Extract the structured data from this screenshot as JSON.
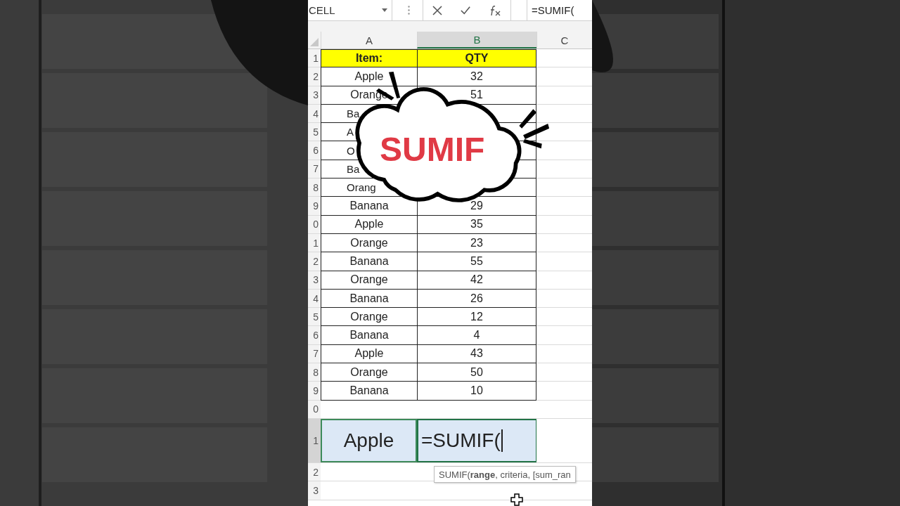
{
  "formula_bar": {
    "name_box": "CELL",
    "formula": "=SUMIF("
  },
  "columns": [
    {
      "label": "A",
      "selected": false
    },
    {
      "label": "B",
      "selected": true
    },
    {
      "label": "C",
      "selected": false
    }
  ],
  "rows": [
    {
      "number": "1",
      "selected": false,
      "kind": "header",
      "cells": [
        {
          "text": "Item:",
          "covered": false
        },
        {
          "text": "QTY",
          "covered": false
        }
      ]
    },
    {
      "number": "2",
      "selected": false,
      "kind": "data",
      "cells": [
        {
          "text": "Apple",
          "covered": false
        },
        {
          "text": "32",
          "covered": false
        }
      ]
    },
    {
      "number": "3",
      "selected": false,
      "kind": "data",
      "cells": [
        {
          "text": "Orange",
          "covered": false
        },
        {
          "text": "51",
          "covered": false
        }
      ]
    },
    {
      "number": "4",
      "selected": false,
      "kind": "data",
      "cells": [
        {
          "text": "Ba",
          "covered": true
        }
      ]
    },
    {
      "number": "5",
      "selected": false,
      "kind": "data",
      "cells": [
        {
          "text": "A",
          "covered": true
        }
      ]
    },
    {
      "number": "6",
      "selected": false,
      "kind": "data",
      "cells": [
        {
          "text": "O",
          "covered": true
        }
      ]
    },
    {
      "number": "7",
      "selected": false,
      "kind": "data",
      "cells": [
        {
          "text": "Ba",
          "covered": true
        }
      ]
    },
    {
      "number": "8",
      "selected": false,
      "kind": "data",
      "cells": [
        {
          "text": "Orang",
          "covered": true
        }
      ]
    },
    {
      "number": "9",
      "selected": false,
      "kind": "data",
      "cells": [
        {
          "text": "Banana",
          "covered": false
        },
        {
          "text": "29",
          "covered": false
        }
      ]
    },
    {
      "number": "0",
      "selected": false,
      "kind": "data",
      "cells": [
        {
          "text": "Apple",
          "covered": false
        },
        {
          "text": "35",
          "covered": false
        }
      ]
    },
    {
      "number": "1",
      "selected": false,
      "kind": "data",
      "cells": [
        {
          "text": "Orange",
          "covered": false
        },
        {
          "text": "23",
          "covered": false
        }
      ]
    },
    {
      "number": "2",
      "selected": false,
      "kind": "data",
      "cells": [
        {
          "text": "Banana",
          "covered": false
        },
        {
          "text": "55",
          "covered": false
        }
      ]
    },
    {
      "number": "3",
      "selected": false,
      "kind": "data",
      "cells": [
        {
          "text": "Orange",
          "covered": false
        },
        {
          "text": "42",
          "covered": false
        }
      ]
    },
    {
      "number": "4",
      "selected": false,
      "kind": "data",
      "cells": [
        {
          "text": "Banana",
          "covered": false
        },
        {
          "text": "26",
          "covered": false
        }
      ]
    },
    {
      "number": "5",
      "selected": false,
      "kind": "data",
      "cells": [
        {
          "text": "Orange",
          "covered": false
        },
        {
          "text": "12",
          "covered": false
        }
      ]
    },
    {
      "number": "6",
      "selected": false,
      "kind": "data",
      "cells": [
        {
          "text": "Banana",
          "covered": false
        },
        {
          "text": "4",
          "covered": false
        }
      ]
    },
    {
      "number": "7",
      "selected": false,
      "kind": "data",
      "cells": [
        {
          "text": "Apple",
          "covered": false
        },
        {
          "text": "43",
          "covered": false
        }
      ]
    },
    {
      "number": "8",
      "selected": false,
      "kind": "data",
      "cells": [
        {
          "text": "Orange",
          "covered": false
        },
        {
          "text": "50",
          "covered": false
        }
      ]
    },
    {
      "number": "9",
      "selected": false,
      "kind": "data",
      "cells": [
        {
          "text": "Banana",
          "covered": false
        },
        {
          "text": "10",
          "covered": false
        }
      ]
    },
    {
      "number": "0",
      "selected": false,
      "kind": "empty",
      "cells": []
    },
    {
      "number": "1",
      "selected": true,
      "kind": "input",
      "cells": [
        {
          "text": "Apple",
          "active": false
        },
        {
          "text": "=SUMIF(",
          "active": true
        }
      ]
    },
    {
      "number": "2",
      "selected": false,
      "kind": "empty",
      "cells": []
    },
    {
      "number": "3",
      "selected": false,
      "kind": "empty",
      "cells": []
    }
  ],
  "callout": {
    "text": "SUMIF"
  },
  "tooltip": {
    "text": "SUMIF(**range**, criteria, [sum_ran"
  }
}
